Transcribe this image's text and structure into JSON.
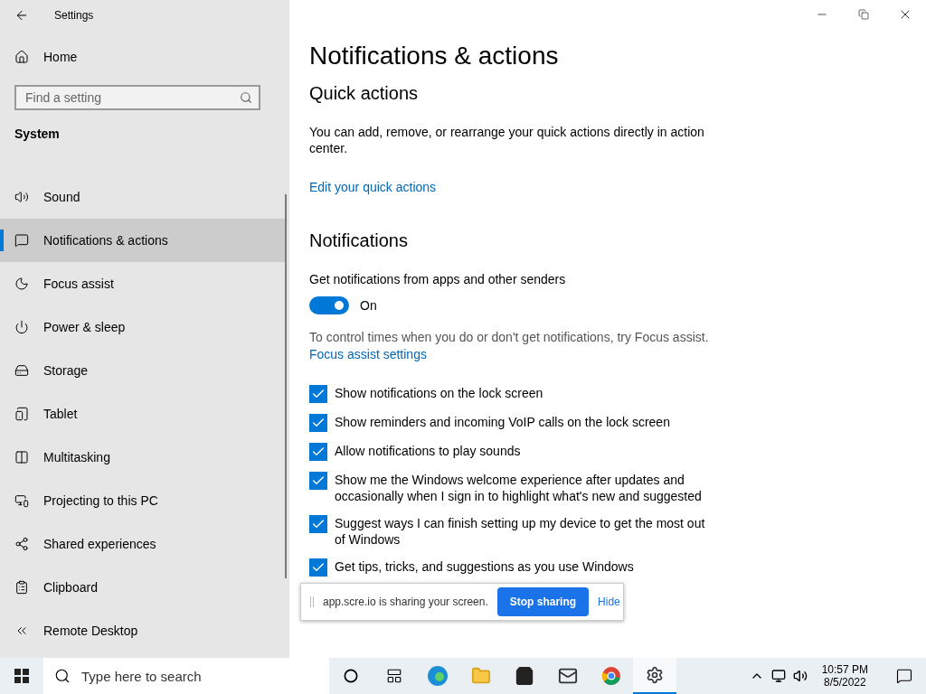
{
  "window": {
    "title": "Settings"
  },
  "sidebar": {
    "home": "Home",
    "search": {
      "placeholder": "Find a setting"
    },
    "section": "System",
    "items": [
      {
        "label": "Sound",
        "selected": false
      },
      {
        "label": "Notifications & actions",
        "selected": true
      },
      {
        "label": "Focus assist",
        "selected": false
      },
      {
        "label": "Power & sleep",
        "selected": false
      },
      {
        "label": "Storage",
        "selected": false
      },
      {
        "label": "Tablet",
        "selected": false
      },
      {
        "label": "Multitasking",
        "selected": false
      },
      {
        "label": "Projecting to this PC",
        "selected": false
      },
      {
        "label": "Shared experiences",
        "selected": false
      },
      {
        "label": "Clipboard",
        "selected": false
      },
      {
        "label": "Remote Desktop",
        "selected": false
      }
    ]
  },
  "main": {
    "title": "Notifications & actions",
    "quick_actions": {
      "heading": "Quick actions",
      "description": "You can add, remove, or rearrange your quick actions directly in action center.",
      "link": "Edit your quick actions"
    },
    "notifications": {
      "heading": "Notifications",
      "toggle_label": "Get notifications from apps and other senders",
      "toggle": {
        "on": true,
        "state_text": "On"
      },
      "hint": "To control times when you do or don't get notifications, try Focus assist.",
      "link": "Focus assist settings",
      "options": [
        {
          "label": "Show notifications on the lock screen",
          "checked": true
        },
        {
          "label": "Show reminders and incoming VoIP calls on the lock screen",
          "checked": true
        },
        {
          "label": "Allow notifications to play sounds",
          "checked": true
        },
        {
          "label": "Show me the Windows welcome experience after updates and occasionally when I sign in to highlight what's new and suggested",
          "checked": true
        },
        {
          "label": "Suggest ways I can finish setting up my device to get the most out of Windows",
          "checked": true
        },
        {
          "label": "Get tips, tricks, and suggestions as you use Windows",
          "checked": true
        }
      ]
    }
  },
  "share_bar": {
    "message": "app.scre.io is sharing your screen.",
    "stop": "Stop sharing",
    "hide": "Hide"
  },
  "taskbar": {
    "search": {
      "placeholder": "Type here to search"
    },
    "time": "10:57 PM",
    "date": "8/5/2022"
  }
}
